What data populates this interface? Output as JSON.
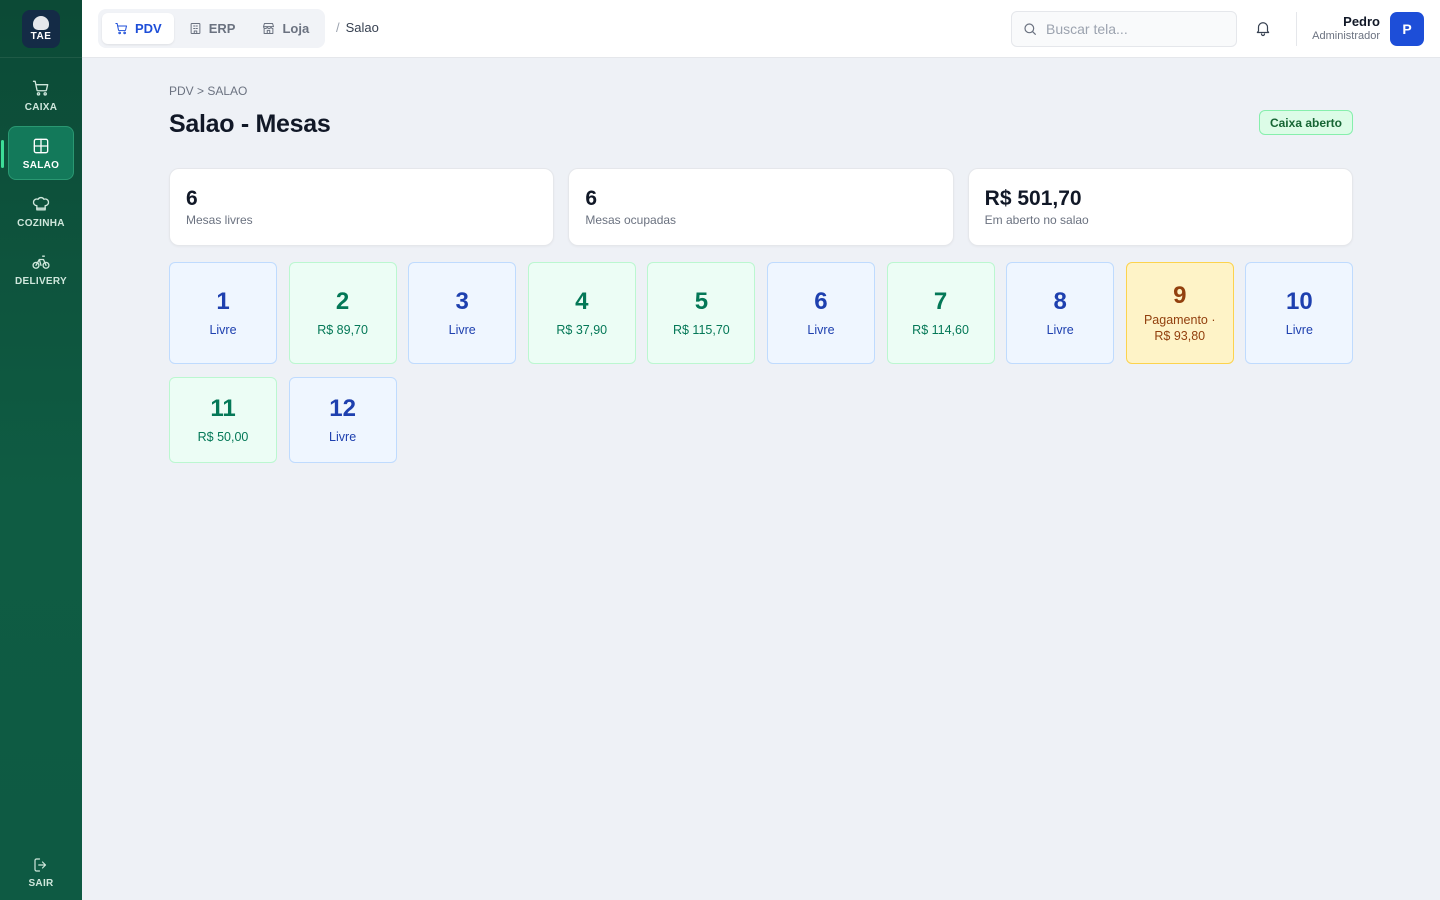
{
  "brand": {
    "logo_text": "TAE"
  },
  "sidebar": {
    "items": [
      {
        "label": "CAIXA",
        "icon": "cart-icon",
        "active": false
      },
      {
        "label": "SALAO",
        "icon": "grid-icon",
        "active": true
      },
      {
        "label": "COZINHA",
        "icon": "chef-hat-icon",
        "active": false
      },
      {
        "label": "DELIVERY",
        "icon": "bicycle-icon",
        "active": false
      }
    ],
    "logout_label": "SAIR"
  },
  "topbar": {
    "modules": [
      {
        "label": "PDV",
        "icon": "cart-icon",
        "active": true
      },
      {
        "label": "ERP",
        "icon": "building-icon",
        "active": false
      },
      {
        "label": "Loja",
        "icon": "store-icon",
        "active": false
      }
    ],
    "current_page": "Salao",
    "search_placeholder": "Buscar tela...",
    "user": {
      "name": "Pedro",
      "role": "Administrador",
      "initial": "P"
    }
  },
  "page": {
    "breadcrumb": "PDV > SALAO",
    "title": "Salao - Mesas",
    "status_badge": "Caixa aberto"
  },
  "stats": [
    {
      "value": "6",
      "label": "Mesas livres"
    },
    {
      "value": "6",
      "label": "Mesas ocupadas"
    },
    {
      "value": "R$ 501,70",
      "label": "Em aberto no salao"
    }
  ],
  "tables": [
    {
      "number": "1",
      "status": "Livre",
      "state": "livre"
    },
    {
      "number": "2",
      "status": "R$ 89,70",
      "state": "ocupada"
    },
    {
      "number": "3",
      "status": "Livre",
      "state": "livre"
    },
    {
      "number": "4",
      "status": "R$ 37,90",
      "state": "ocupada"
    },
    {
      "number": "5",
      "status": "R$ 115,70",
      "state": "ocupada"
    },
    {
      "number": "6",
      "status": "Livre",
      "state": "livre"
    },
    {
      "number": "7",
      "status": "R$ 114,60",
      "state": "ocupada"
    },
    {
      "number": "8",
      "status": "Livre",
      "state": "livre"
    },
    {
      "number": "9",
      "status": "Pagamento · R$ 93,80",
      "state": "pagamento"
    },
    {
      "number": "10",
      "status": "Livre",
      "state": "livre"
    },
    {
      "number": "11",
      "status": "R$ 50,00",
      "state": "ocupada"
    },
    {
      "number": "12",
      "status": "Livre",
      "state": "livre"
    }
  ],
  "colors": {
    "sidebar_bg": "#0c4a36",
    "accent_blue": "#1d4ed8",
    "free_bg": "#eff6ff",
    "occupied_bg": "#ecfdf5",
    "payment_bg": "#fef3c7",
    "badge_green": "#dcfce7"
  }
}
